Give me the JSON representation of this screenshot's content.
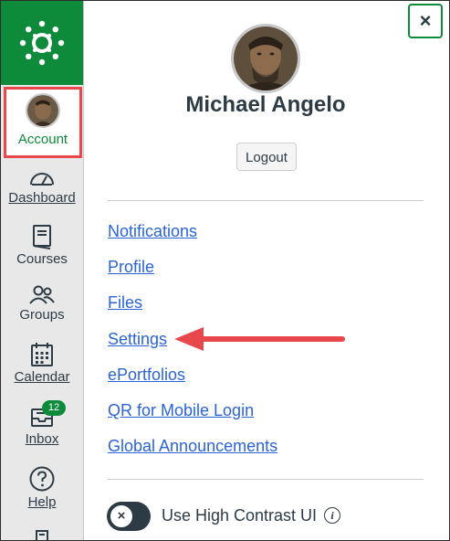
{
  "colors": {
    "brand": "#0e8a3b",
    "link": "#2b64d8",
    "highlight": "#e8474b",
    "text": "#2d3b45"
  },
  "global_nav": {
    "items": [
      {
        "label": "Account",
        "icon": "avatar"
      },
      {
        "label": "Dashboard",
        "icon": "dashboard-icon"
      },
      {
        "label": "Courses",
        "icon": "courses-icon"
      },
      {
        "label": "Groups",
        "icon": "groups-icon"
      },
      {
        "label": "Calendar",
        "icon": "calendar-icon"
      },
      {
        "label": "Inbox",
        "icon": "inbox-icon",
        "badge": "12"
      },
      {
        "label": "Help",
        "icon": "help-icon"
      }
    ]
  },
  "tray": {
    "close_label": "×",
    "user_name": "Michael Angelo",
    "logout_label": "Logout",
    "links": [
      "Notifications",
      "Profile",
      "Files",
      "Settings",
      "ePortfolios",
      "QR for Mobile Login",
      "Global Announcements"
    ],
    "toggle": {
      "label": "Use High Contrast UI",
      "knob": "×",
      "info": "i"
    }
  }
}
